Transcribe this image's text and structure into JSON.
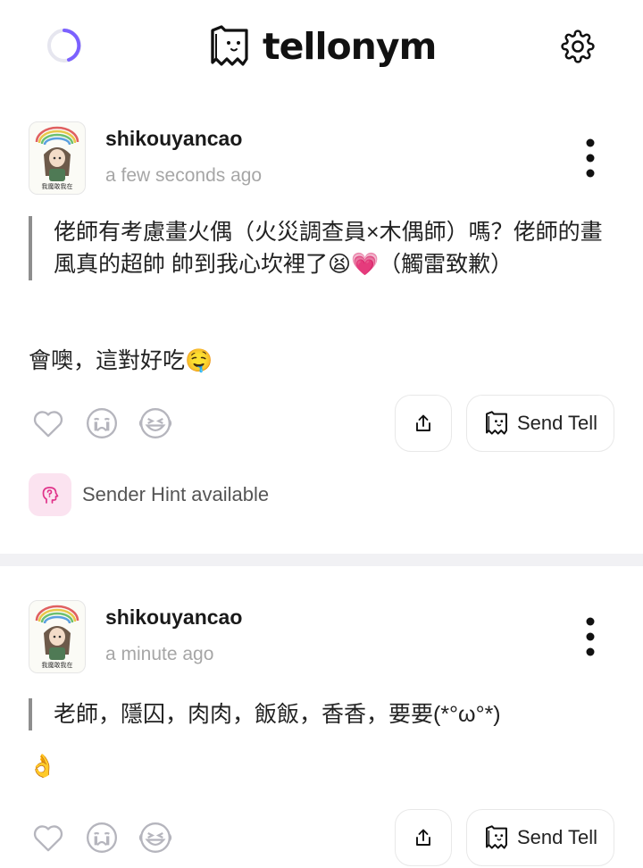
{
  "app": {
    "logo_text": "tellonym"
  },
  "icons": {
    "loading": "loading-spinner-icon",
    "logo": "tellonym-logo-icon",
    "settings": "gear-icon",
    "more": "more-vertical-icon",
    "like": "heart-icon",
    "cry": "crying-face-icon",
    "laugh": "laughing-face-icon",
    "share": "share-icon",
    "tell": "tellonym-logo-icon",
    "hint": "sender-hint-icon"
  },
  "colors": {
    "accent": "#7b61ff",
    "hint_bg": "#fbe3f0",
    "hint_icon": "#e0338a"
  },
  "posts": [
    {
      "username": "shikouyancao",
      "time": "a few seconds ago",
      "avatar_caption": "我魔敢我在",
      "question": "佬師有考慮畫火偶（火災調查員×木偶師）嗎？佬師的畫風真的超帥 帥到我心坎裡了😫💗（觸雷致歉）",
      "answer": "會噢，這對好吃🤤",
      "send_tell_label": "Send Tell",
      "sender_hint": "Sender Hint available"
    },
    {
      "username": "shikouyancao",
      "time": "a minute ago",
      "avatar_caption": "我魔敢我在",
      "question": "老師，隱囚，肉肉，飯飯，香香，要要(*°ω°*)",
      "answer": "👌",
      "send_tell_label": "Send Tell"
    }
  ]
}
